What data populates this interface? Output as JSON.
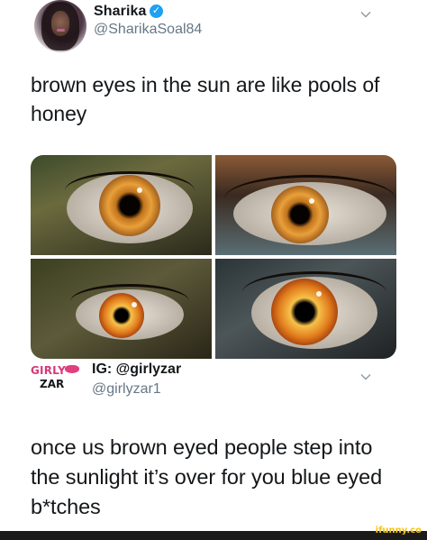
{
  "tweets": [
    {
      "author_name": "Sharika",
      "verified_mark": "✓",
      "handle": "@SharikaSoal84",
      "text": "brown eyes in the sun are like pools of honey"
    },
    {
      "author_name": "IG: @girlyzar",
      "handle": "@girlyzar1",
      "text": "once us brown eyed people step into the sunlight it’s over for you blue eyed b*tches",
      "logo": {
        "line1": "GIRLY",
        "line2": "ZAR"
      }
    }
  ],
  "watermark": "ifunny.co",
  "colors": {
    "text": "#14171a",
    "handle": "#657786",
    "verified": "#1da1f2",
    "brand_pink": "#d63a7a",
    "watermark": "#f5c518"
  },
  "icons": [
    "verified-badge-icon",
    "chevron-down-icon",
    "lips-icon"
  ]
}
